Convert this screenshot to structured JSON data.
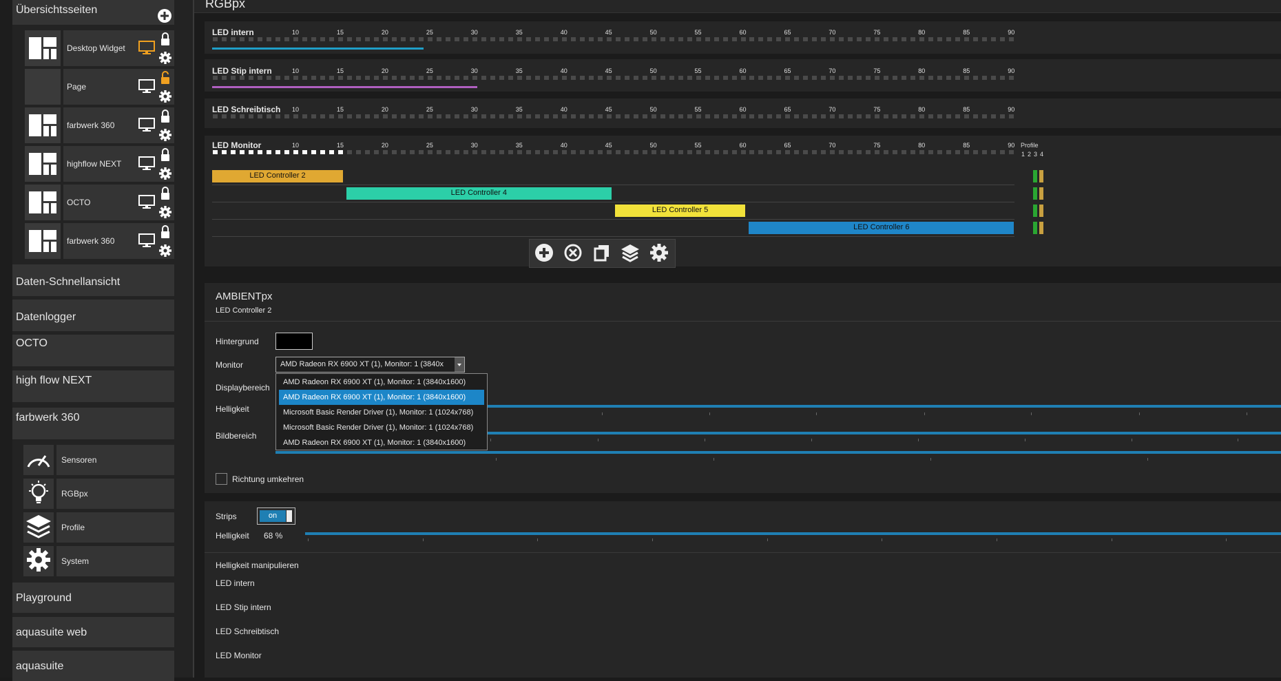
{
  "sidebar": {
    "overview_title": "Übersichtsseiten",
    "pages": [
      {
        "label": "Desktop Widget",
        "display_color": "#f0a020",
        "lock_color": "#ffffff",
        "unlocked": false,
        "thumb": true
      },
      {
        "label": "Page",
        "display_color": "#ffffff",
        "lock_color": "#f0a020",
        "unlocked": true,
        "thumb": false
      },
      {
        "label": "farbwerk 360",
        "display_color": "#ffffff",
        "lock_color": "#ffffff",
        "unlocked": false,
        "thumb": true
      },
      {
        "label": "highflow NEXT",
        "display_color": "#ffffff",
        "lock_color": "#ffffff",
        "unlocked": false,
        "thumb": true
      },
      {
        "label": "OCTO",
        "display_color": "#ffffff",
        "lock_color": "#ffffff",
        "unlocked": false,
        "thumb": true
      },
      {
        "label": "farbwerk 360",
        "display_color": "#ffffff",
        "lock_color": "#ffffff",
        "unlocked": false,
        "thumb": true
      }
    ],
    "sections": [
      "Daten-Schnellansicht",
      "Datenlogger",
      "OCTO",
      "high flow NEXT",
      "farbwerk 360"
    ],
    "device_items": [
      {
        "label": "Sensoren",
        "icon": "gauge-icon"
      },
      {
        "label": "RGBpx",
        "icon": "lightbulb-icon"
      },
      {
        "label": "Profile",
        "icon": "layers-icon"
      },
      {
        "label": "System",
        "icon": "gear-icon"
      }
    ],
    "bottom_sections": [
      "Playground",
      "aquasuite web",
      "aquasuite"
    ]
  },
  "main": {
    "page_title": "RGBpx",
    "ticks": [
      "10",
      "15",
      "20",
      "25",
      "30",
      "35",
      "40",
      "45",
      "50",
      "55",
      "60",
      "65",
      "70",
      "75",
      "80",
      "85",
      "90"
    ],
    "led_rows": [
      {
        "title": "LED intern",
        "bar_color": "#1f9fc8",
        "bar_end": 24
      },
      {
        "title": "LED Stip intern",
        "bar_color": "#b05fc0",
        "bar_end": 30
      },
      {
        "title": "LED Schreibtisch",
        "bar_color": "",
        "bar_end": 0
      }
    ],
    "monitor": {
      "title": "LED Monitor",
      "lit_leds": 15,
      "profile_label": "Profile",
      "profile_numbers": [
        "1",
        "2",
        "3",
        "4"
      ],
      "controllers": [
        {
          "label": "LED Controller 2",
          "start": 1,
          "end": 15,
          "color": "#e0a832"
        },
        {
          "label": "LED Controller 4",
          "start": 16,
          "end": 45,
          "color": "#2ccfa8"
        },
        {
          "label": "LED Controller 5",
          "start": 46,
          "end": 60,
          "color": "#f2e23a"
        },
        {
          "label": "LED Controller 6",
          "start": 61,
          "end": 90,
          "color": "#1f86c8"
        }
      ],
      "profile_colors": [
        "#2aa632",
        "#c8a040"
      ]
    },
    "ambient": {
      "title": "AMBIENTpx",
      "subtitle": "LED Controller 2",
      "background_label": "Hintergrund",
      "background_color": "#000000",
      "monitor_label": "Monitor",
      "monitor_value": "AMD Radeon RX 6900 XT (1), Monitor: 1 (3840x",
      "display_area_label": "Displaybereich",
      "brightness_label": "Helligkeit",
      "image_area_label": "Bildbereich",
      "dropdown_options": [
        "AMD Radeon RX 6900 XT (1), Monitor: 1 (3840x1600)",
        "AMD Radeon RX 6900 XT (1), Monitor: 1 (3840x1600)",
        "Microsoft Basic Render Driver (1), Monitor: 1 (1024x768)",
        "Microsoft Basic Render Driver (1), Monitor: 1 (1024x768)",
        "AMD Radeon RX 6900 XT (1), Monitor: 1 (3840x1600)"
      ],
      "selected_option": 1,
      "reverse_label": "Richtung umkehren"
    },
    "strips": {
      "label": "Strips",
      "toggle": "on",
      "brightness_label": "Helligkeit",
      "brightness_value": "68 %"
    },
    "manipulate": {
      "title": "Helligkeit manipulieren",
      "items": [
        "LED intern",
        "LED Stip intern",
        "LED Schreibtisch",
        "LED Monitor"
      ]
    }
  }
}
